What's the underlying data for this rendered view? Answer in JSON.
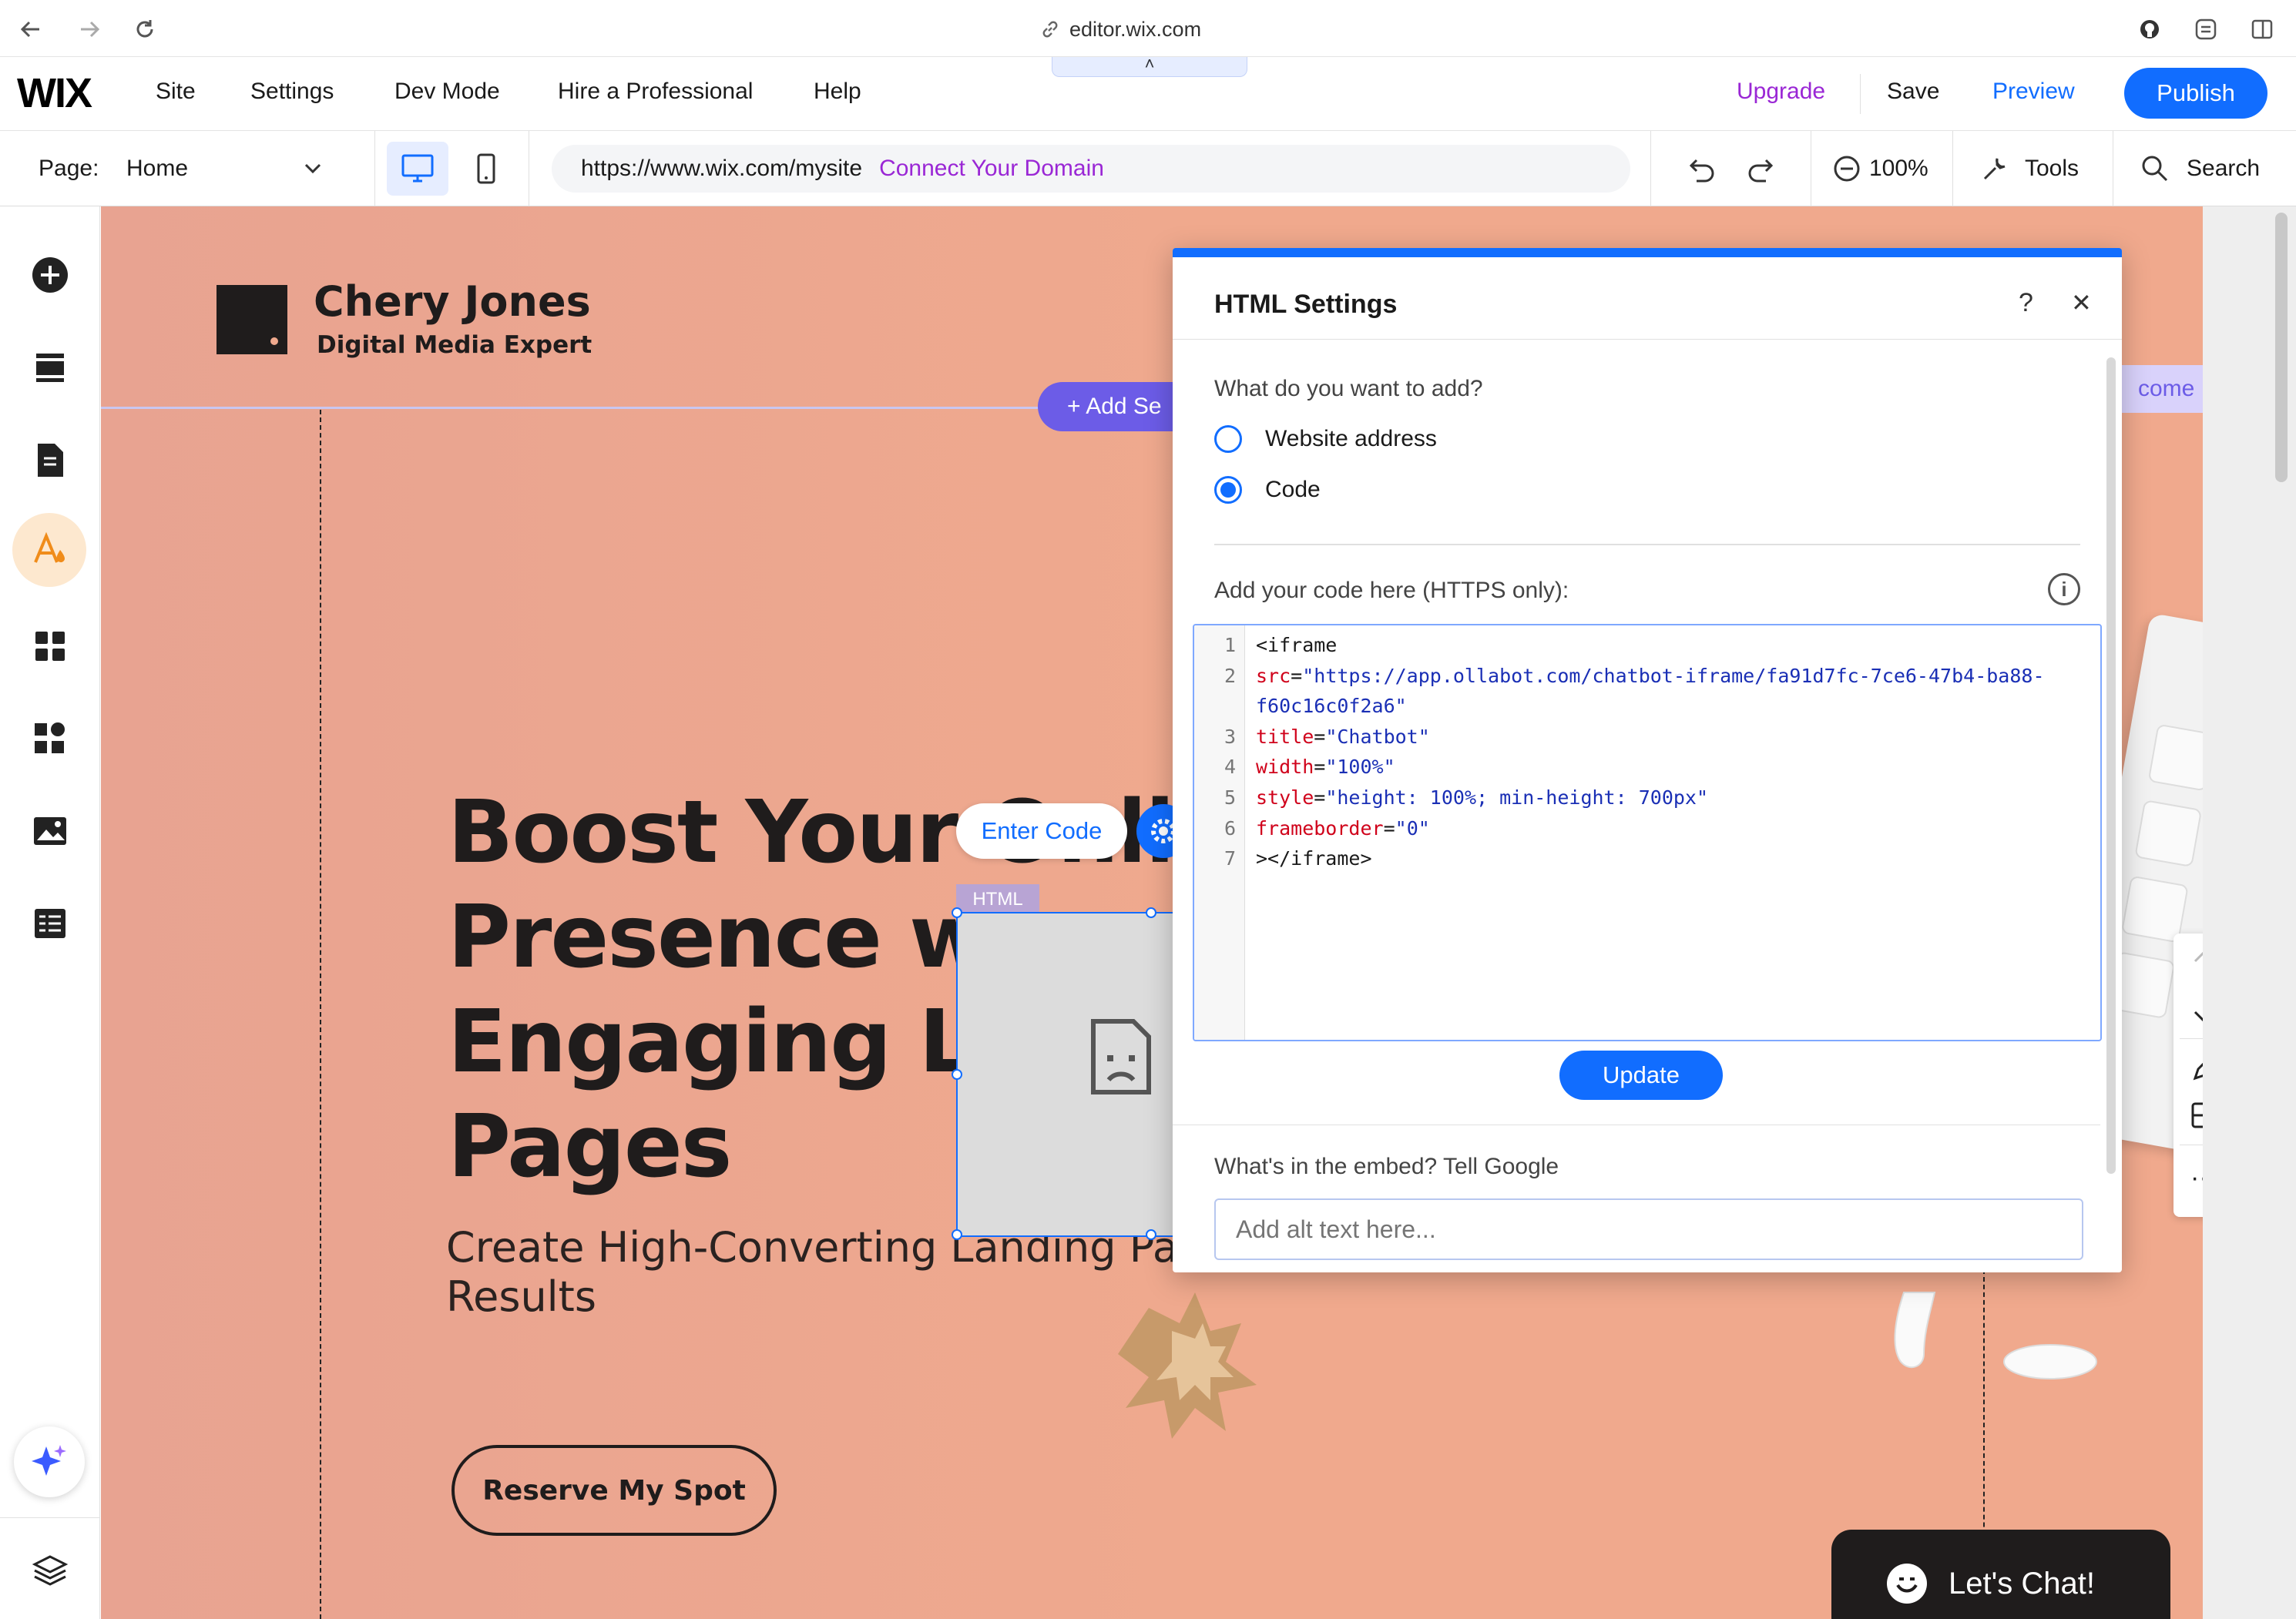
{
  "browser": {
    "url_text": "editor.wix.com",
    "back_icon": "arrow-left-icon",
    "forward_icon": "arrow-right-icon",
    "reload_icon": "reload-icon"
  },
  "top_menu": {
    "logo": "WIX",
    "items": [
      "Site",
      "Settings",
      "Dev Mode",
      "Hire a Professional",
      "Help"
    ],
    "upgrade": "Upgrade",
    "save": "Save",
    "preview": "Preview",
    "publish": "Publish",
    "drawer_chevron": "˄"
  },
  "second_bar": {
    "page_label": "Page:",
    "page_value": "Home",
    "site_url": "https://www.wix.com/mysite",
    "connect_domain": "Connect Your Domain",
    "zoom": "100%",
    "tools": "Tools",
    "search": "Search"
  },
  "site": {
    "brand_name": "Chery Jones",
    "brand_tagline": "Digital Media Expert",
    "add_section": "+ Add Se",
    "welcome_fragment": "come",
    "hero_title_lines": [
      "Boost Your Onli",
      "Presence w",
      "Engaging L",
      "Pages"
    ],
    "hero_subtitle_lines": [
      "Create High-Converting Landing Pa",
      "Results"
    ],
    "cta_button": "Reserve My Spot",
    "enter_code": "Enter Code",
    "html_tag": "HTML",
    "chat_button": "Let's Chat!"
  },
  "dialog": {
    "title": "HTML Settings",
    "help": "?",
    "close": "✕",
    "question": "What do you want to add?",
    "options": [
      "Website address",
      "Code"
    ],
    "selected_option": "Code",
    "code_label": "Add your code here (HTTPS only):",
    "info": "i",
    "code_lines": [
      {
        "num": "1",
        "parts": [
          {
            "t": "tag",
            "s": "<iframe"
          }
        ]
      },
      {
        "num": "2",
        "parts": [
          {
            "t": "attr",
            "s": "src"
          },
          {
            "t": "tag",
            "s": "="
          },
          {
            "t": "val",
            "s": "\"https://app.ollabot.com/chatbot-iframe/fa91d7fc-7ce6-47b4-ba88-"
          }
        ]
      },
      {
        "num": "",
        "parts": [
          {
            "t": "val",
            "s": "f60c16c0f2a6\""
          }
        ]
      },
      {
        "num": "3",
        "parts": [
          {
            "t": "attr",
            "s": "title"
          },
          {
            "t": "tag",
            "s": "="
          },
          {
            "t": "val",
            "s": "\"Chatbot\""
          }
        ]
      },
      {
        "num": "4",
        "parts": [
          {
            "t": "attr",
            "s": "width"
          },
          {
            "t": "tag",
            "s": "="
          },
          {
            "t": "val",
            "s": "\"100%\""
          }
        ]
      },
      {
        "num": "5",
        "parts": [
          {
            "t": "attr",
            "s": "style"
          },
          {
            "t": "tag",
            "s": "="
          },
          {
            "t": "val",
            "s": "\"height: 100%; min-height: 700px\""
          }
        ]
      },
      {
        "num": "6",
        "parts": [
          {
            "t": "attr",
            "s": "frameborder"
          },
          {
            "t": "tag",
            "s": "="
          },
          {
            "t": "val",
            "s": "\"0\""
          }
        ]
      },
      {
        "num": "7",
        "parts": [
          {
            "t": "tag",
            "s": "></iframe>"
          }
        ]
      }
    ],
    "update_button": "Update",
    "embed_label": "What's in the embed? Tell Google",
    "alt_placeholder": "Add alt text here..."
  },
  "colors": {
    "accent": "#116dff",
    "upgrade": "#9a27d5",
    "canvas_bg": "#f0a98d",
    "add_section": "#6c5ce7"
  }
}
